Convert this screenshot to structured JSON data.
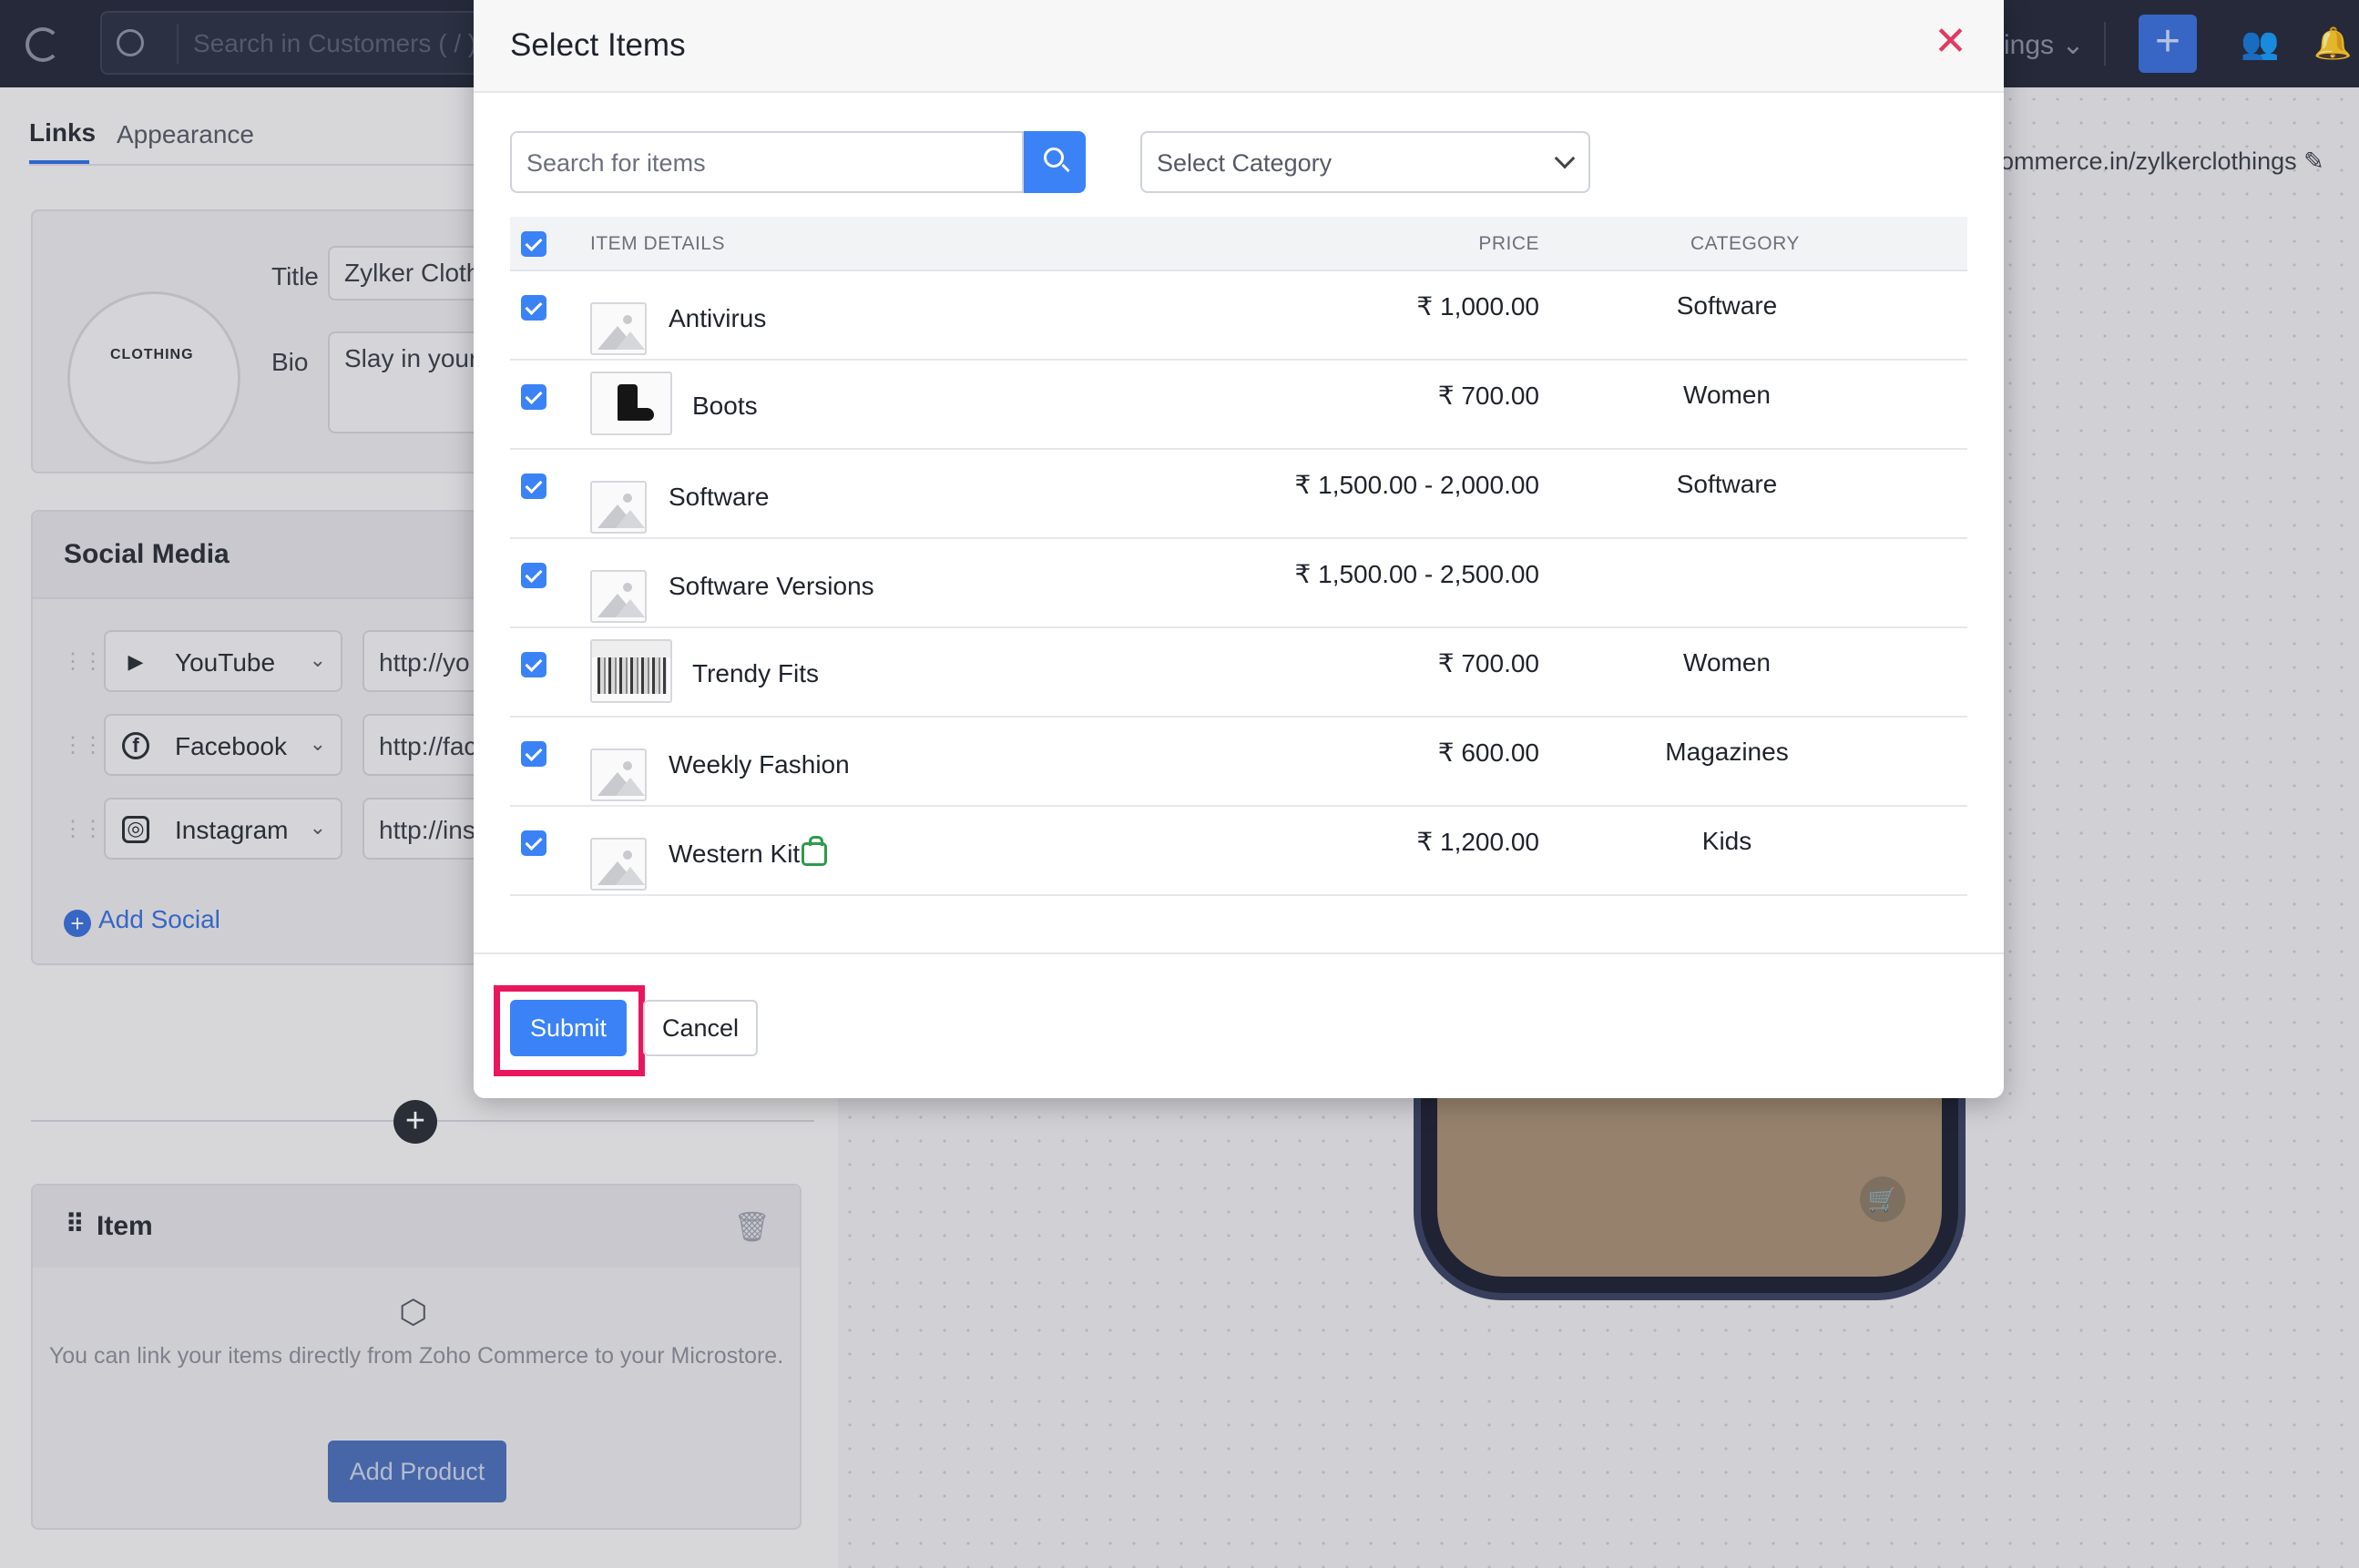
{
  "topbar": {
    "search_placeholder": "Search in Customers ( / )",
    "settings_label": "ings ⌄"
  },
  "left": {
    "tabs": [
      "Links",
      "Appearance"
    ],
    "profile": {
      "title_label": "Title",
      "title_value": "Zylker Clothing",
      "bio_label": "Bio",
      "bio_value": "Slay in your",
      "logo_text": "CLOTHING"
    },
    "social": {
      "heading": "Social Media",
      "rows": [
        {
          "name": "YouTube",
          "url": "http://yo",
          "icon": "youtube-icon"
        },
        {
          "name": "Facebook",
          "url": "http://fac",
          "icon": "facebook-icon"
        },
        {
          "name": "Instagram",
          "url": "http://ins",
          "icon": "instagram-icon"
        }
      ],
      "add_label": "Add Social"
    },
    "item_card": {
      "heading": "Item",
      "message": "You can link your items directly from Zoho Commerce to your Microstore.",
      "add_button": "Add Product"
    }
  },
  "right": {
    "store_url": "ommerce.in/zylkerclothings"
  },
  "modal": {
    "title": "Select Items",
    "search_placeholder": "Search for items",
    "category_placeholder": "Select Category",
    "columns": {
      "details": "ITEM DETAILS",
      "price": "PRICE",
      "category": "CATEGORY"
    },
    "items": [
      {
        "name": "Antivirus",
        "price": "₹ 1,000.00",
        "category": "Software",
        "checked": true
      },
      {
        "name": "Boots",
        "price": "₹ 700.00",
        "category": "Women",
        "checked": true
      },
      {
        "name": "Software",
        "price": "₹ 1,500.00 - 2,000.00",
        "category": "Software",
        "checked": true
      },
      {
        "name": "Software Versions",
        "price": "₹ 1,500.00 - 2,500.00",
        "category": "",
        "checked": true
      },
      {
        "name": "Trendy Fits",
        "price": "₹ 700.00",
        "category": "Women",
        "checked": true
      },
      {
        "name": "Weekly Fashion",
        "price": "₹ 600.00",
        "category": "Magazines",
        "checked": true
      },
      {
        "name": "Western Kit",
        "price": "₹ 1,200.00",
        "category": "Kids",
        "checked": true
      }
    ],
    "submit_label": "Submit",
    "cancel_label": "Cancel",
    "accent": "#3b82f6",
    "highlight_color": "#e8175d"
  }
}
